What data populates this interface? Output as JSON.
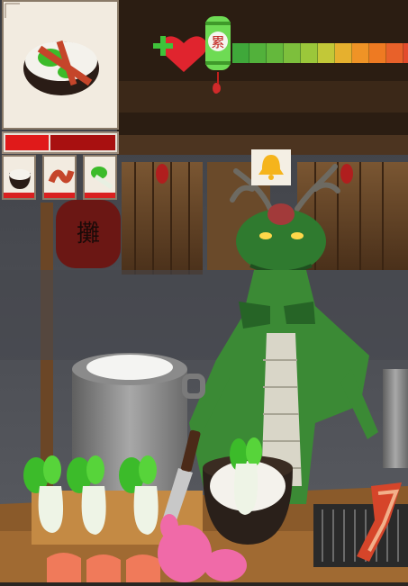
{
  "order": {
    "dish": "rice-bowl-with-bacon-and-bok-choy",
    "progress_fraction": 0.38,
    "ingredients": [
      {
        "name": "rice-icon"
      },
      {
        "name": "bacon-icon"
      },
      {
        "name": "bok-choy-icon"
      }
    ]
  },
  "hud": {
    "lantern_glyph": "累",
    "patience_segments": 11,
    "colors": {
      "health_heart": "#e0242e",
      "plus": "#3fc23a",
      "lantern": "#6edb54",
      "meter": [
        "#3fa83a",
        "#52b13b",
        "#64b83c",
        "#7dbf3c",
        "#9bc73a",
        "#c2c838",
        "#e6b02e",
        "#ef9326",
        "#ee7a22",
        "#e8612a",
        "#e24b2d"
      ]
    }
  },
  "customer": {
    "type": "dragon-customer",
    "request_icon": "bell-icon"
  },
  "counter": {
    "items": [
      "rice-pot",
      "bok-choy",
      "bok-choy",
      "bok-choy",
      "cleaver",
      "bowl-of-rice",
      "salmon-slices",
      "rabbit-hand",
      "grill",
      "bacon-strip"
    ]
  }
}
